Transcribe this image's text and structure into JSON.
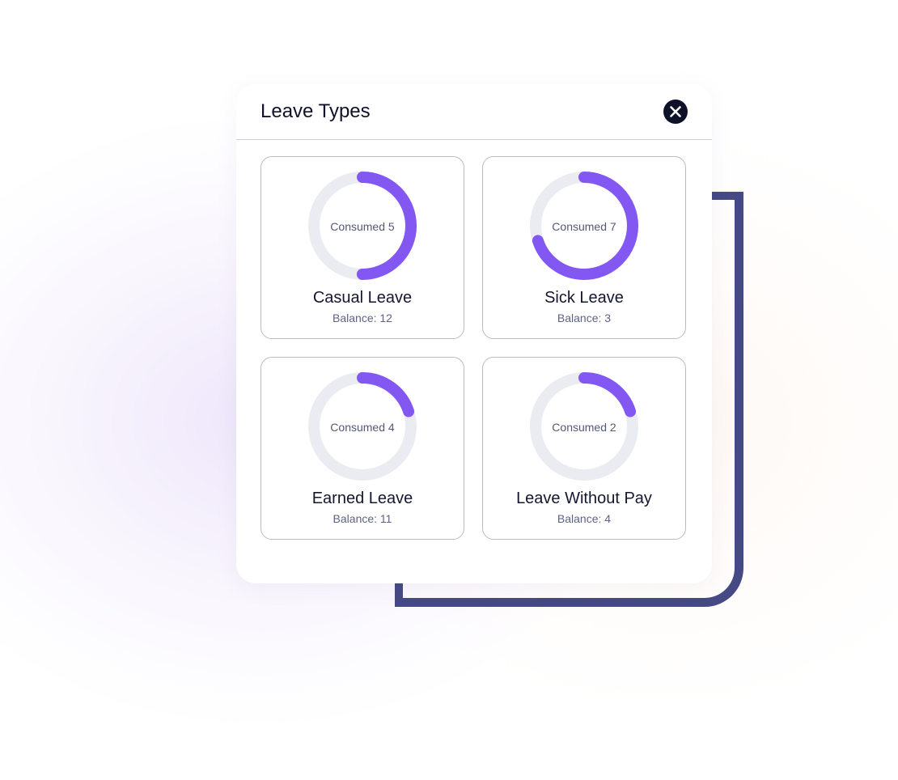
{
  "modal": {
    "title": "Leave Types",
    "close_icon": "close-icon"
  },
  "colors": {
    "accent": "#8358f2",
    "track": "#ebebf2",
    "frame": "#454a85",
    "close_bg": "#0e1128"
  },
  "leave_types": [
    {
      "name": "Casual Leave",
      "consumed_label": "Consumed 5",
      "balance_label": "Balance: 12",
      "consumed": 5,
      "balance": 12,
      "progress": 0.5
    },
    {
      "name": "Sick Leave",
      "consumed_label": "Consumed 7",
      "balance_label": "Balance: 3",
      "consumed": 7,
      "balance": 3,
      "progress": 0.7
    },
    {
      "name": "Earned Leave",
      "consumed_label": "Consumed 4",
      "balance_label": "Balance: 11",
      "consumed": 4,
      "balance": 11,
      "progress": 0.2
    },
    {
      "name": "Leave Without Pay",
      "consumed_label": "Consumed 2",
      "balance_label": "Balance: 4",
      "consumed": 2,
      "balance": 4,
      "progress": 0.2
    }
  ]
}
